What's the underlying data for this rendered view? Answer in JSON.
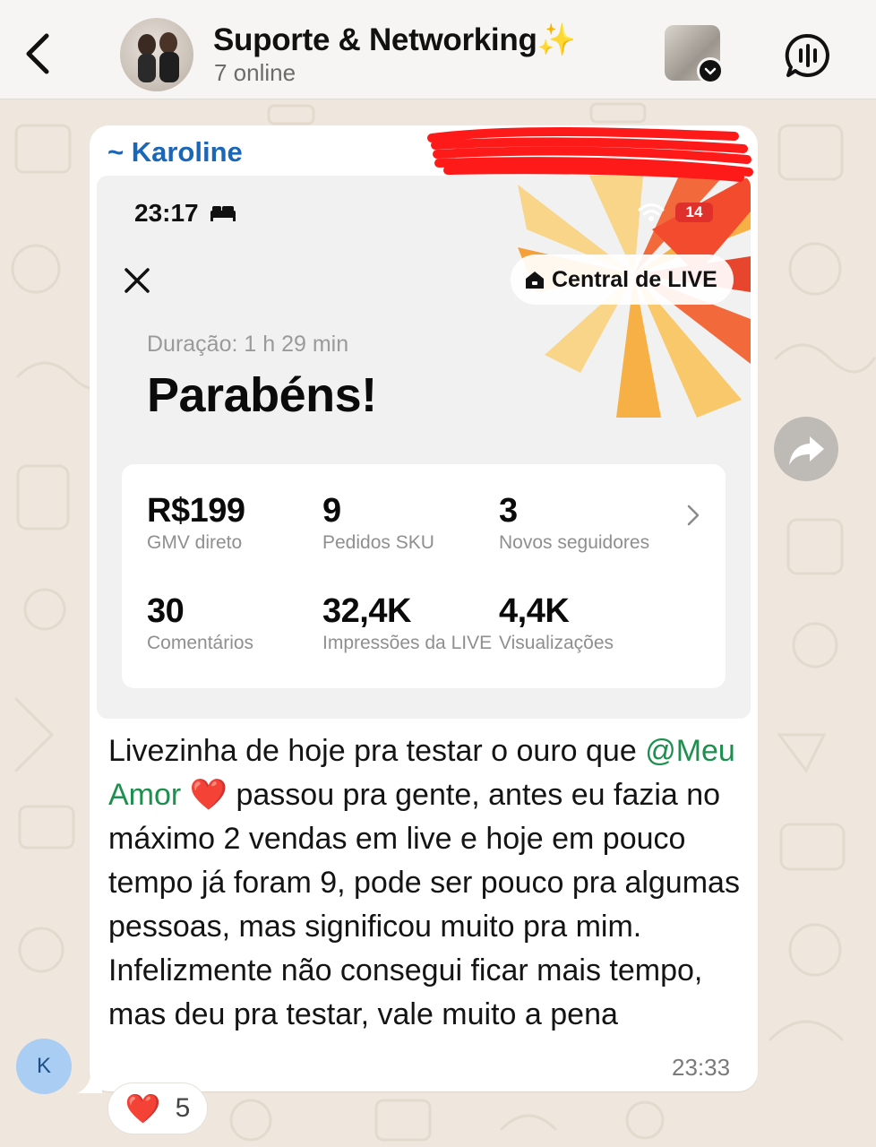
{
  "header": {
    "title": "Suporte & Networking",
    "title_emoji": "✨",
    "subtitle": "7 online"
  },
  "message": {
    "sender": "~ Karoline",
    "sender_initial": "K",
    "text_before_mention": "Livezinha de hoje pra testar o ouro que ",
    "mention": "@Meu Amor",
    "heart_emoji": "❤️",
    "text_after_mention": " passou pra gente, antes eu fazia no máximo 2 vendas em live e hoje em pouco tempo já foram 9, pode ser pouco pra algumas pessoas, mas significou muito pra mim. Infelizmente não consegui ficar mais tempo, mas deu pra testar, vale muito a pena",
    "time": "23:33",
    "reaction": {
      "emoji": "❤️",
      "count": "5"
    }
  },
  "embedded_screenshot": {
    "status_time": "23:17",
    "battery": "14",
    "live_center_label": "Central de LIVE",
    "duration": "Duração: 1 h 29 min",
    "headline": "Parabéns!",
    "stats": [
      {
        "value": "R$199",
        "label": "GMV direto"
      },
      {
        "value": "9",
        "label": "Pedidos SKU"
      },
      {
        "value": "3",
        "label": "Novos seguidores"
      },
      {
        "value": "30",
        "label": "Comentários"
      },
      {
        "value": "32,4K",
        "label": "Impressões da LIVE"
      },
      {
        "value": "4,4K",
        "label": "Visualizações"
      }
    ]
  },
  "colors": {
    "mention": "#1d8f4e",
    "sender_name": "#1a66b8",
    "wallpaper": "#efe7dd",
    "redaction": "#ff1a1a"
  },
  "icons": [
    "back-chevron-icon",
    "group-avatar",
    "media-thumbnail",
    "audio-call-icon",
    "forward-icon",
    "close-icon",
    "home-icon",
    "wifi-icon",
    "bed-icon",
    "chevron-right-icon"
  ]
}
